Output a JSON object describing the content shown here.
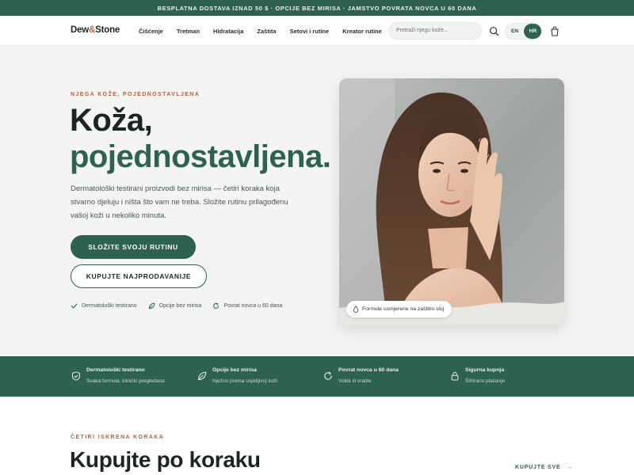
{
  "announcement": "BESPLATNA DOSTAVA IZNAD 50 $ · OPCIJE BEZ MIRISA · JAMSTVO POVRATA NOVCA U 60 DANA",
  "brand": {
    "part1": "Dew",
    "amp": "&",
    "part2": "Stone"
  },
  "nav": {
    "items": [
      {
        "label": "Čišćenje"
      },
      {
        "label": "Tretman"
      },
      {
        "label": "Hidratacija"
      },
      {
        "label": "Zaštita"
      },
      {
        "label": "Setovi i rutine"
      },
      {
        "label": "Kreator rutine"
      }
    ],
    "search_placeholder": "Pretraži njegu kože...",
    "lang_en": "EN",
    "lang_hr": "HR"
  },
  "hero": {
    "eyebrow": "NJEGA KOŽE, POJEDNOSTAVLJENA",
    "title_line1": "Koža,",
    "title_line2": "pojednostavljena.",
    "lead": "Dermatološki testirani proizvodi bez mirisa — četiri koraka koja stvarno djeluju i ništa što vam ne treba. Složite rutinu prilagođenu vašoj koži u nekoliko minuta.",
    "cta_primary": "SLOŽITE SVOJU RUTINU",
    "cta_secondary": "KUPUJTE NAJPRODAVANIJE",
    "perks": [
      {
        "icon": "check-icon",
        "label": "Dermatološki testirano"
      },
      {
        "icon": "leaf-icon",
        "label": "Opcije bez mirisa"
      },
      {
        "icon": "refresh-icon",
        "label": "Povrat novca u 60 dana"
      }
    ],
    "photo_badge": "Formule usmjerene na zaštitni sloj"
  },
  "features": [
    {
      "icon": "shield-icon",
      "title": "Dermatološki testirano",
      "desc": "Svaka formula, klinički pregledana"
    },
    {
      "icon": "leaf-icon",
      "title": "Opcije bez mirisa",
      "desc": "Nježno prema osjetljivoj koži"
    },
    {
      "icon": "refresh-icon",
      "title": "Povrat novca u 60 dana",
      "desc": "Volite ili vratite"
    },
    {
      "icon": "lock-icon",
      "title": "Sigurna kupnja",
      "desc": "Šifrirano plaćanje"
    }
  ],
  "section": {
    "eyebrow": "ČETIRI ISKRENA KORAKA",
    "title": "Kupujte po koraku",
    "link": "KUPUJTE SVE"
  },
  "colors": {
    "primary": "#2d6150",
    "accent": "#b4623f",
    "background": "#f4f5f3"
  }
}
